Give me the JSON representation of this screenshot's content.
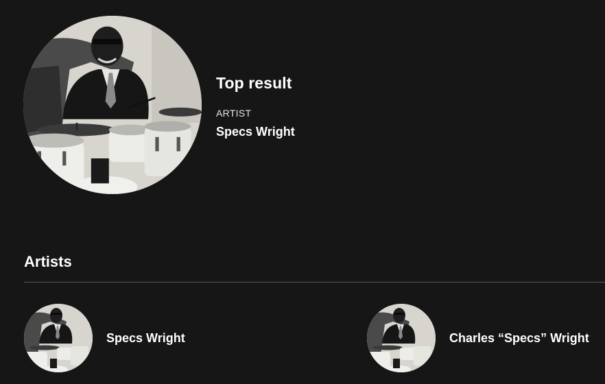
{
  "top_result": {
    "heading": "Top result",
    "type": "ARTIST",
    "name": "Specs Wright",
    "image_icon": "artist-photo-drummer"
  },
  "artists_section": {
    "title": "Artists",
    "items": [
      {
        "name": "Specs Wright",
        "image_icon": "artist-photo-drummer"
      },
      {
        "name": "Charles “Specs” Wright",
        "image_icon": "artist-photo-drummer"
      }
    ]
  },
  "colors": {
    "background": "#161616",
    "text": "#ffffff",
    "divider": "#585858"
  }
}
